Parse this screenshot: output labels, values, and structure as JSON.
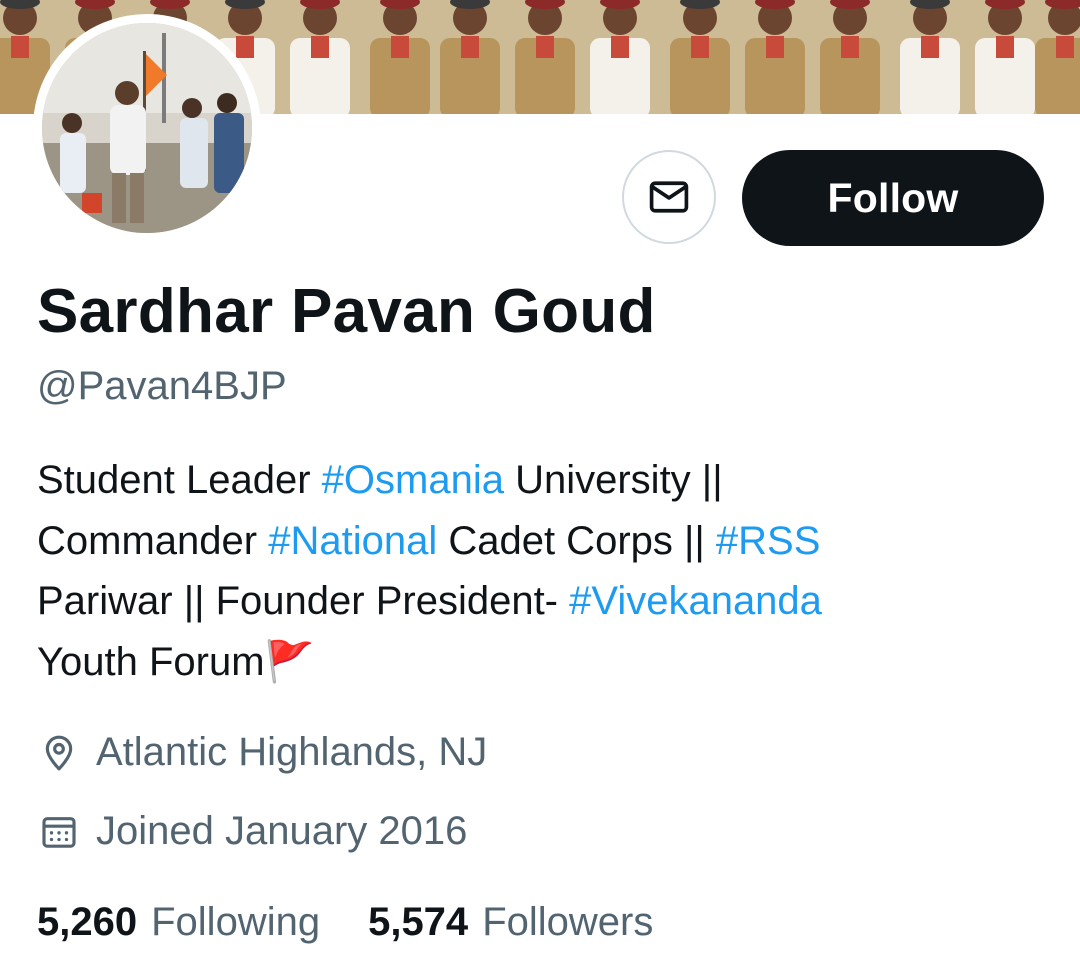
{
  "profile": {
    "display_name": "Sardhar Pavan Goud",
    "handle": "@Pavan4BJP",
    "bio": {
      "line1": {
        "a": "Student Leader ",
        "tag": "#Osmania",
        "b": " University ||"
      },
      "line2": {
        "a": "Commander ",
        "tag1": "#National",
        "b": " Cadet Corps || ",
        "tag2": "#RSS"
      },
      "line3": {
        "a": "Pariwar || Founder President- ",
        "tag": "#Vivekananda"
      },
      "line4": {
        "a": "Youth Forum",
        "emoji": "🚩"
      }
    },
    "location": "Atlantic Highlands, NJ",
    "joined": "Joined January 2016",
    "following_count": "5,260",
    "following_label": "Following",
    "followers_count": "5,574",
    "followers_label": "Followers"
  },
  "actions": {
    "follow_label": "Follow",
    "message_icon": "envelope-icon"
  },
  "icons": {
    "location": "map-pin-icon",
    "joined": "calendar-icon"
  },
  "colors": {
    "text_primary": "#0f1419",
    "text_secondary": "#536471",
    "link": "#1d9bf0",
    "button_dark": "#0f1419",
    "border": "#cfd9de"
  }
}
